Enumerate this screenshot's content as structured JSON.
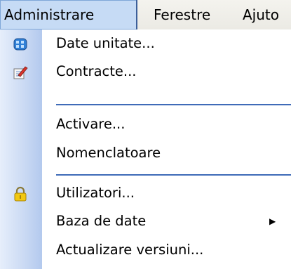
{
  "menubar": {
    "items": [
      {
        "label": "Administrare"
      },
      {
        "label": "Ferestre"
      },
      {
        "label": "Ajuto"
      }
    ]
  },
  "menu": {
    "items": [
      {
        "label": "Date unitate...",
        "icon": "building-icon"
      },
      {
        "label": "Contracte...",
        "icon": "document-edit-icon"
      },
      {
        "label": "Activare..."
      },
      {
        "label": "Nomenclatoare"
      },
      {
        "label": "Utilizatori...",
        "icon": "lock-icon"
      },
      {
        "label": "Baza de date",
        "submenu": true
      },
      {
        "label": "Actualizare versiuni..."
      }
    ]
  },
  "colors": {
    "icon_column": "#c9d9f3",
    "separator": "#3f6bb8",
    "active_menu_bg": "#c6dbf5"
  }
}
